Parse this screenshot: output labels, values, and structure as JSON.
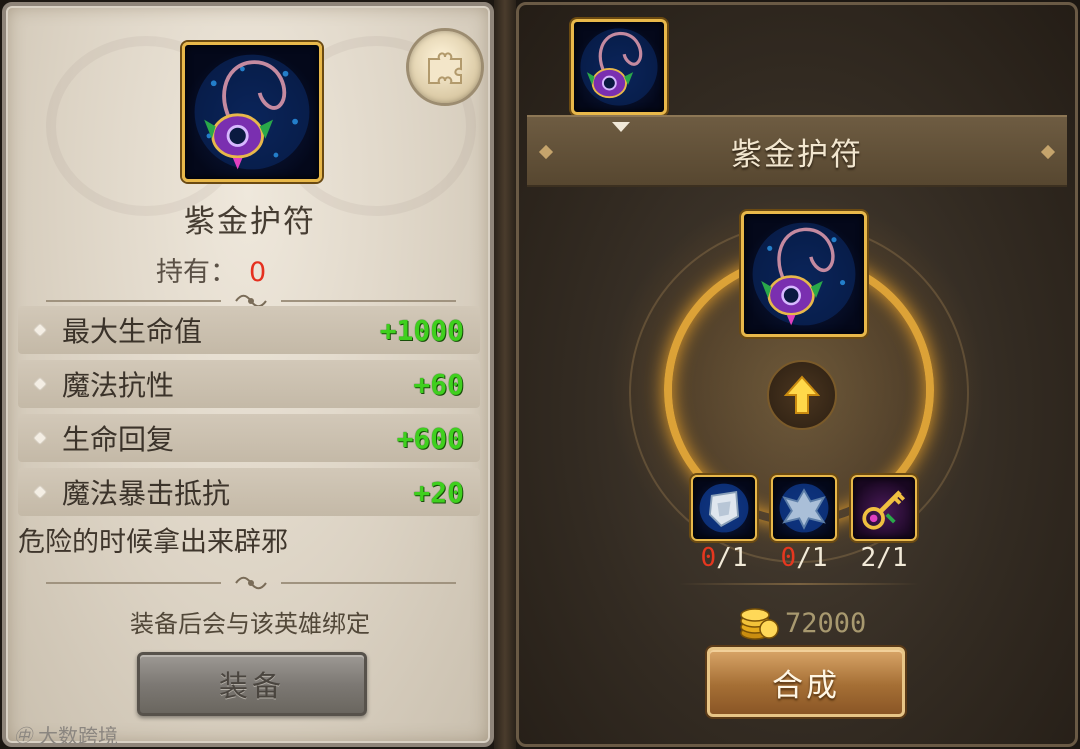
{
  "item": {
    "name": "紫金护符",
    "hold_label": "持有：",
    "hold_count": "0",
    "description": "危险的时候拿出来辟邪",
    "bind_notice": "装备后会与该英雄绑定",
    "equip_label": "装备",
    "stats": [
      {
        "label": "最大生命值",
        "value": "+1000"
      },
      {
        "label": "魔法抗性",
        "value": "+60"
      },
      {
        "label": "生命回复",
        "value": "+600"
      },
      {
        "label": "魔法暴击抵抗",
        "value": "+20"
      }
    ]
  },
  "craft": {
    "title": "紫金护符",
    "materials": [
      {
        "icon": "crystal-shield-icon",
        "have": "0",
        "need": "/1"
      },
      {
        "icon": "silver-wing-emblem-icon",
        "have": "0",
        "need": "/1"
      },
      {
        "icon": "golden-key-icon",
        "have": "2",
        "need": "/1"
      }
    ],
    "cost": "72000",
    "craft_label": "合成"
  },
  "watermark": {
    "logo": "㊥",
    "text": "大数跨境"
  },
  "colors": {
    "stat_value": "#3fd01e",
    "count_zero": "#e5301f",
    "gold_frame": "#e8b84a",
    "glow": "#f5b43a"
  }
}
